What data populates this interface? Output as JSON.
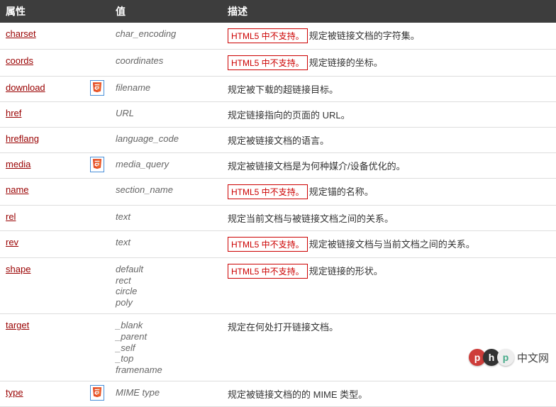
{
  "headers": {
    "attr": "属性",
    "value": "值",
    "desc": "描述"
  },
  "deprecated_label": "HTML5 中不支持。",
  "rows": [
    {
      "attr": "charset",
      "html5_new": false,
      "values": [
        "char_encoding"
      ],
      "deprecated": true,
      "desc": "规定被链接文档的字符集。"
    },
    {
      "attr": "coords",
      "html5_new": false,
      "values": [
        "coordinates"
      ],
      "deprecated": true,
      "desc": "规定链接的坐标。"
    },
    {
      "attr": "download",
      "html5_new": true,
      "values": [
        "filename"
      ],
      "deprecated": false,
      "desc": "规定被下载的超链接目标。"
    },
    {
      "attr": "href",
      "html5_new": false,
      "values": [
        "URL"
      ],
      "deprecated": false,
      "desc": "规定链接指向的页面的 URL。"
    },
    {
      "attr": "hreflang",
      "html5_new": false,
      "values": [
        "language_code"
      ],
      "deprecated": false,
      "desc": "规定被链接文档的语言。"
    },
    {
      "attr": "media",
      "html5_new": true,
      "values": [
        "media_query"
      ],
      "deprecated": false,
      "desc": "规定被链接文档是为何种媒介/设备优化的。"
    },
    {
      "attr": "name",
      "html5_new": false,
      "values": [
        "section_name"
      ],
      "deprecated": true,
      "desc": "规定锚的名称。"
    },
    {
      "attr": "rel",
      "html5_new": false,
      "values": [
        "text"
      ],
      "deprecated": false,
      "desc": "规定当前文档与被链接文档之间的关系。"
    },
    {
      "attr": "rev",
      "html5_new": false,
      "values": [
        "text"
      ],
      "deprecated": true,
      "desc": "规定被链接文档与当前文档之间的关系。"
    },
    {
      "attr": "shape",
      "html5_new": false,
      "values": [
        "default",
        "rect",
        "circle",
        "poly"
      ],
      "deprecated": true,
      "desc": "规定链接的形状。"
    },
    {
      "attr": "target",
      "html5_new": false,
      "values": [
        "_blank",
        "_parent",
        "_self",
        "_top",
        "framename"
      ],
      "deprecated": false,
      "desc": "规定在何处打开链接文档。"
    },
    {
      "attr": "type",
      "html5_new": true,
      "values": [
        "MIME type"
      ],
      "deprecated": false,
      "desc": "规定被链接文档的的 MIME 类型。"
    }
  ],
  "logo_text": "中文网"
}
